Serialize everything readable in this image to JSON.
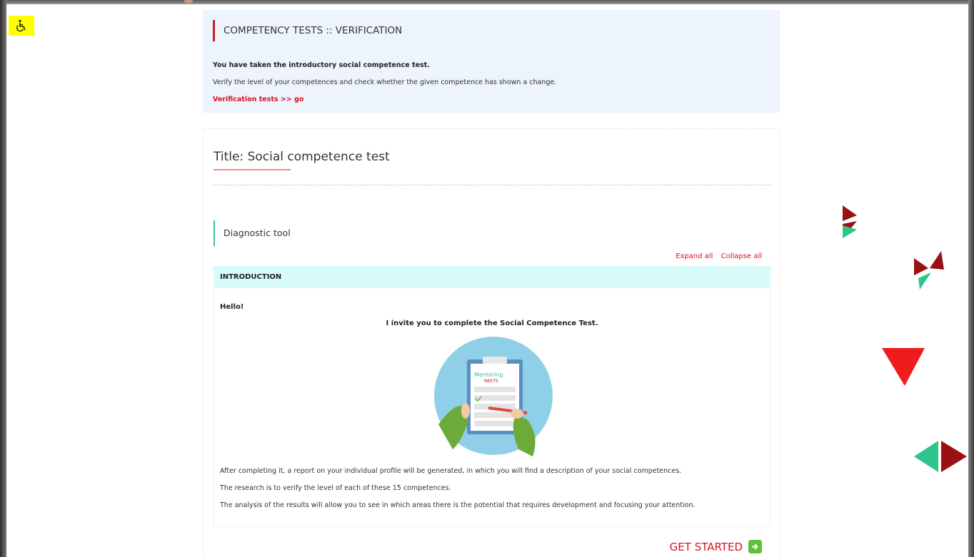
{
  "accessibility": {
    "icon": "wheelchair-icon",
    "color": "#ffff00"
  },
  "notice": {
    "title": "COMPETENCY TESTS :: VERIFICATION",
    "bold_text": "You have taken the introductory social competence test.",
    "text": "Verify the level of your competences and check whether the given competence has shown a change.",
    "link": "Verification tests >> go"
  },
  "card": {
    "title": "Title: Social competence test",
    "section_label": "Diagnostic tool",
    "expand_all": "Expand all",
    "collapse_all": "Collapse all",
    "intro_header": "INTRODUCTION",
    "hello": "Hello!",
    "invite": "I invite you to complete the Social Competence Test.",
    "paragraphs": [
      "After completing it, a report on your individual profile will be generated, in which you will find a description of your social competences.",
      "The research is to verify the level of each of these 15 competences.",
      "The analysis of the results will allow you to see in which areas there is the potential that requires development and focusing your attention."
    ],
    "illustration": {
      "logo_text_1": "Mentoring",
      "logo_text_2": "NEETS"
    },
    "get_started": "GET STARTED"
  },
  "colors": {
    "accent_red": "#d8121d",
    "accent_green": "#3dbf99",
    "dark_red": "#9b1111"
  }
}
